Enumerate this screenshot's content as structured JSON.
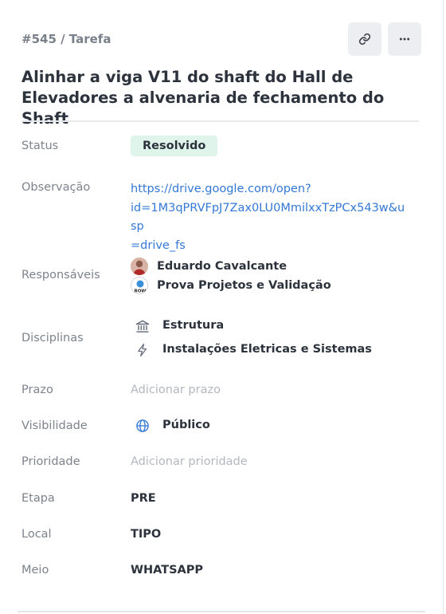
{
  "task": {
    "id_label": "#545 / Tarefa",
    "title": "Alinhar a viga V11 do shaft do Hall de Elevadores a alvenaria de fechamento do Shaft"
  },
  "actions": {
    "copy_link_icon": "link-icon",
    "more_icon": "more-horizontal-icon"
  },
  "fields": {
    "status": {
      "label": "Status",
      "value": "Resolvido",
      "color": "#dff4ea"
    },
    "observacao": {
      "label": "Observação",
      "lines": [
        "https://drive.google.com/open?",
        "id=1M3qPRVFpJ7Zax0LU0MmilxxTzPCx543w&usp",
        "=drive_fs"
      ]
    },
    "responsaveis": {
      "label": "Responsáveis",
      "people": [
        {
          "name": "Eduardo Cavalcante"
        },
        {
          "name": "Prova Projetos e Validação",
          "avatar_text": "ROW"
        }
      ]
    },
    "disciplinas": {
      "label": "Disciplinas",
      "items": [
        {
          "name": "Estrutura",
          "icon": "building-columns-icon"
        },
        {
          "name": "Instalações Eletricas e Sistemas",
          "icon": "lightning-bolt-icon"
        }
      ]
    },
    "prazo": {
      "label": "Prazo",
      "placeholder": "Adicionar prazo"
    },
    "visibilidade": {
      "label": "Visibilidade",
      "value": "Público",
      "icon": "globe-icon"
    },
    "prioridade": {
      "label": "Prioridade",
      "placeholder": "Adicionar prioridade"
    },
    "etapa": {
      "label": "Etapa",
      "value": "PRE"
    },
    "local": {
      "label": "Local",
      "value": "TIPO"
    },
    "meio": {
      "label": "Meio",
      "value": "WHATSAPP"
    }
  },
  "colors": {
    "link": "#3478d6",
    "label": "#7d838c",
    "badge_bg": "#dff4ea",
    "icon_btn_bg": "#eceef1"
  }
}
